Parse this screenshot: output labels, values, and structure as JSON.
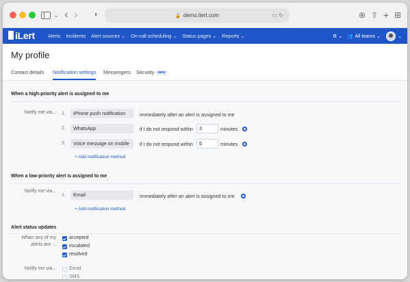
{
  "browser": {
    "url": "demo.ilert.com",
    "chevrons": "⌄",
    "nav_back": "‹",
    "nav_forward": "›",
    "shield": "◐",
    "reader": "▭ ↻",
    "actions": [
      "⊕",
      "⇧",
      "+",
      "⊞"
    ]
  },
  "app": {
    "logo": "iLert",
    "nav": [
      {
        "label": "Alerts"
      },
      {
        "label": "Incidents"
      },
      {
        "label": "Alert sources ⌄"
      },
      {
        "label": "On-call scheduling ⌄"
      },
      {
        "label": "Status pages ⌄"
      },
      {
        "label": "Reports ⌄"
      }
    ],
    "settings_icon": "⚙ ⌄",
    "teams_icon": "👥",
    "teams_label": "All teams ⌄",
    "avatar_caret": "⌄"
  },
  "page": {
    "title": "My profile",
    "tabs": [
      {
        "label": "Contact details"
      },
      {
        "label": "Notification settings"
      },
      {
        "label": "Messengers"
      },
      {
        "label": "Security"
      }
    ],
    "security_badge": "NEW"
  },
  "high": {
    "title": "When a high-priority alert is assigned to me",
    "notify_label": "Notify me via...",
    "rows": [
      {
        "num": "1.",
        "method": "iPhone push notification",
        "text": "immediately after an alert is assigned to me"
      },
      {
        "num": "2.",
        "method": "WhatsApp",
        "text": "if I do not respond within",
        "minutes": "3",
        "unit": "minutes"
      },
      {
        "num": "3.",
        "method": "Voice message on mobile",
        "text": "if I do not respond within",
        "minutes": "5",
        "unit": "minutes"
      }
    ],
    "add_link": "+ Add notification method"
  },
  "low": {
    "title": "When a low-priority alert is assigned to me",
    "notify_label": "Notify me via...",
    "rows": [
      {
        "num": "1.",
        "method": "Email",
        "text": "immediately after an alert is assigned to me"
      }
    ],
    "add_link": "+ Add notification method"
  },
  "status": {
    "title": "Alert status updates",
    "when_label_1": "When any of my",
    "when_label_2": "alerts are ...",
    "states": [
      {
        "label": "accepted",
        "checked": true
      },
      {
        "label": "escalated",
        "checked": true
      },
      {
        "label": "resolved",
        "checked": true
      }
    ],
    "notify_label": "Notify me via...",
    "channels": [
      {
        "label": "Email",
        "checked": false
      },
      {
        "label": "SMS",
        "checked": false
      }
    ]
  },
  "colors": {
    "accent": "#1f55c7",
    "nav_bg": "#1f55c7"
  }
}
